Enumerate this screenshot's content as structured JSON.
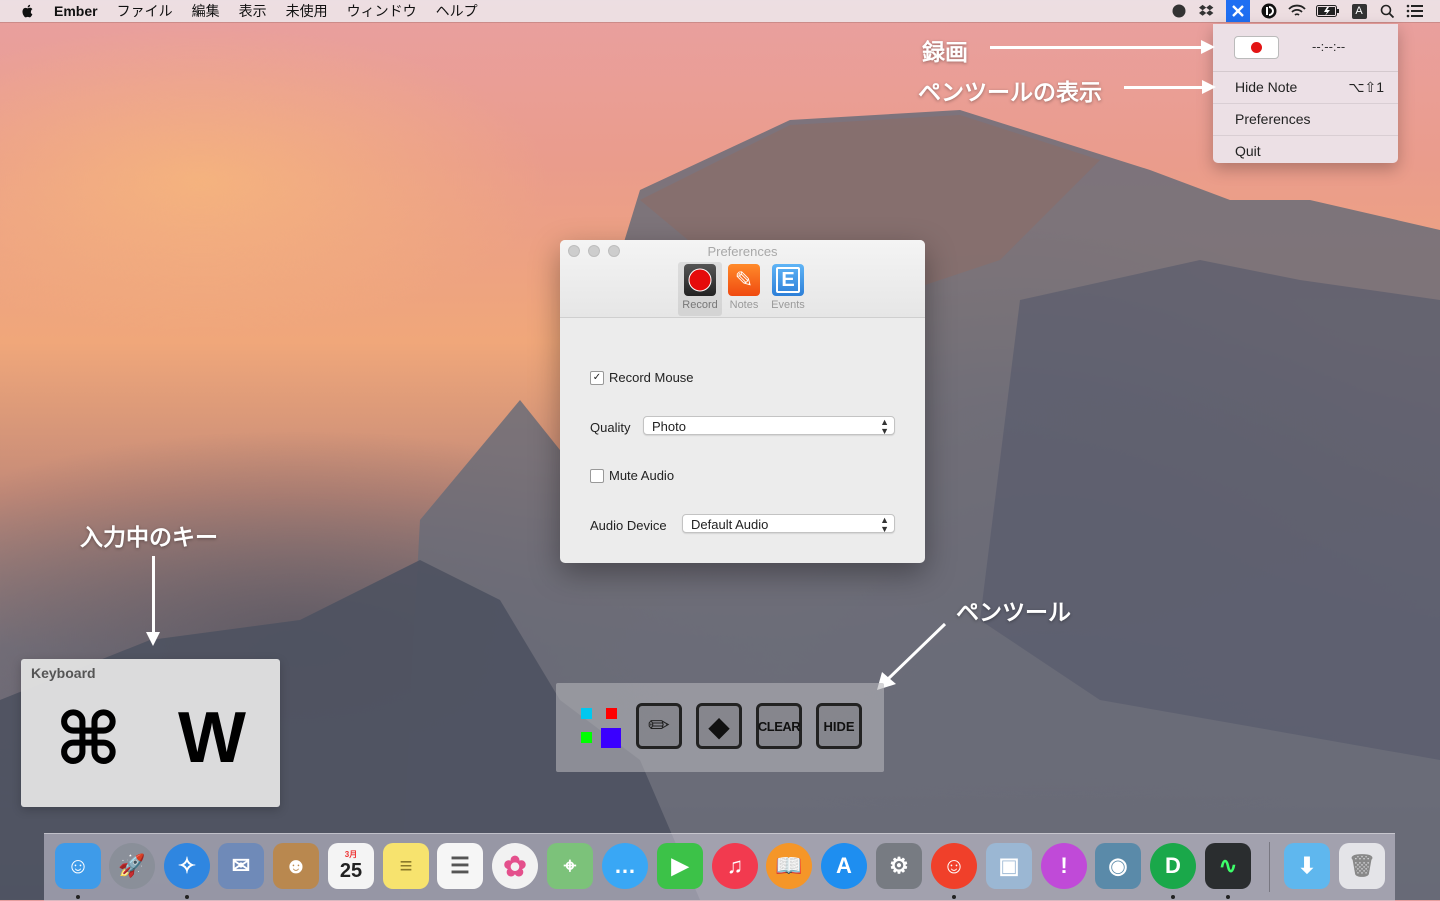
{
  "menubar": {
    "app_name": "Ember",
    "items": [
      "ファイル",
      "編集",
      "表示",
      "未使用",
      "ウィンドウ",
      "ヘルプ"
    ],
    "status_icons": [
      "profile-icon",
      "dropbox-icon",
      "ember-icon",
      "ebook-icon",
      "wifi-icon",
      "battery-icon",
      "input-method-icon",
      "spotlight-icon",
      "notification-center-icon"
    ],
    "input_method_label": "A"
  },
  "dropdown": {
    "timer": "--:--:--",
    "items": [
      {
        "label": "Hide Note",
        "shortcut": "⌥⇧1"
      },
      {
        "label": "Preferences",
        "shortcut": ""
      },
      {
        "label": "Quit",
        "shortcut": ""
      }
    ]
  },
  "annotations": {
    "record": "録画",
    "pen_display": "ペンツールの表示",
    "keys": "入力中のキー",
    "pen_tool": "ペンツール"
  },
  "preferences": {
    "title": "Preferences",
    "tabs": [
      {
        "label": "Record",
        "icon": "record-icon"
      },
      {
        "label": "Notes",
        "icon": "notes-icon",
        "glyph": "✎"
      },
      {
        "label": "Events",
        "icon": "events-icon",
        "glyph": "E"
      }
    ],
    "record_mouse_label": "Record Mouse",
    "record_mouse_checked": true,
    "check_glyph": "✓",
    "quality_label": "Quality",
    "quality_value": "Photo",
    "mute_audio_label": "Mute Audio",
    "mute_audio_checked": false,
    "audio_device_label": "Audio Device",
    "audio_device_value": "Default Audio",
    "select_arrows": [
      "▲",
      "▼"
    ]
  },
  "keyboard": {
    "title": "Keyboard",
    "keys": [
      "⌘",
      "W"
    ]
  },
  "pentool": {
    "colors": [
      "#00c8f0",
      "#ff0000",
      "#00ff00",
      "#3a00ff"
    ],
    "buttons": [
      {
        "name": "pencil",
        "label": "",
        "glyph": "✏"
      },
      {
        "name": "eraser",
        "label": "",
        "glyph": "◆"
      },
      {
        "name": "clear",
        "label": "CLEAR"
      },
      {
        "name": "hide",
        "label": "HIDE"
      }
    ]
  },
  "dock": {
    "apps": [
      {
        "name": "finder",
        "color": "#3e9be9",
        "glyph": "☺"
      },
      {
        "name": "launchpad",
        "color": "#8a8f99",
        "glyph": "🚀"
      },
      {
        "name": "safari",
        "color": "#2f86e0",
        "glyph": "✧"
      },
      {
        "name": "mail",
        "color": "#6f8ab8",
        "glyph": "✉"
      },
      {
        "name": "contacts",
        "color": "#b9884f",
        "glyph": "☻"
      },
      {
        "name": "calendar",
        "color": "#f4f4f4",
        "glyph": "25",
        "subtext": "3月"
      },
      {
        "name": "notes",
        "color": "#f7e36e",
        "glyph": "≡"
      },
      {
        "name": "reminders",
        "color": "#f6f6f6",
        "glyph": "☰"
      },
      {
        "name": "photos",
        "color": "#f2f2f2",
        "glyph": "✿"
      },
      {
        "name": "maps",
        "color": "#7cc27a",
        "glyph": "⌖"
      },
      {
        "name": "messages",
        "color": "#39a7f5",
        "glyph": "…"
      },
      {
        "name": "facetime",
        "color": "#3cc248",
        "glyph": "▶"
      },
      {
        "name": "itunes",
        "color": "#f23a4f",
        "glyph": "♫"
      },
      {
        "name": "ibooks",
        "color": "#f59628",
        "glyph": "📖"
      },
      {
        "name": "app-store",
        "color": "#1e8ef0",
        "glyph": "A"
      },
      {
        "name": "system-preferences",
        "color": "#777b82",
        "glyph": "⚙"
      },
      {
        "name": "ember-app",
        "color": "#f0402a",
        "glyph": "☺"
      },
      {
        "name": "preview",
        "color": "#9bb7d3",
        "glyph": "▣"
      },
      {
        "name": "feedback",
        "color": "#c04ad8",
        "glyph": "!"
      },
      {
        "name": "image-capture",
        "color": "#5a8aa9",
        "glyph": "◉"
      },
      {
        "name": "ebook-reader",
        "color": "#1aa84a",
        "glyph": "D"
      },
      {
        "name": "activity-monitor",
        "color": "#2a2d2f",
        "glyph": "∿"
      }
    ],
    "downloads": {
      "name": "downloads",
      "color": "#5fb7ee",
      "glyph": "⬇"
    },
    "trash": {
      "name": "trash",
      "color": "#e4e4e8",
      "glyph": "🗑"
    }
  }
}
